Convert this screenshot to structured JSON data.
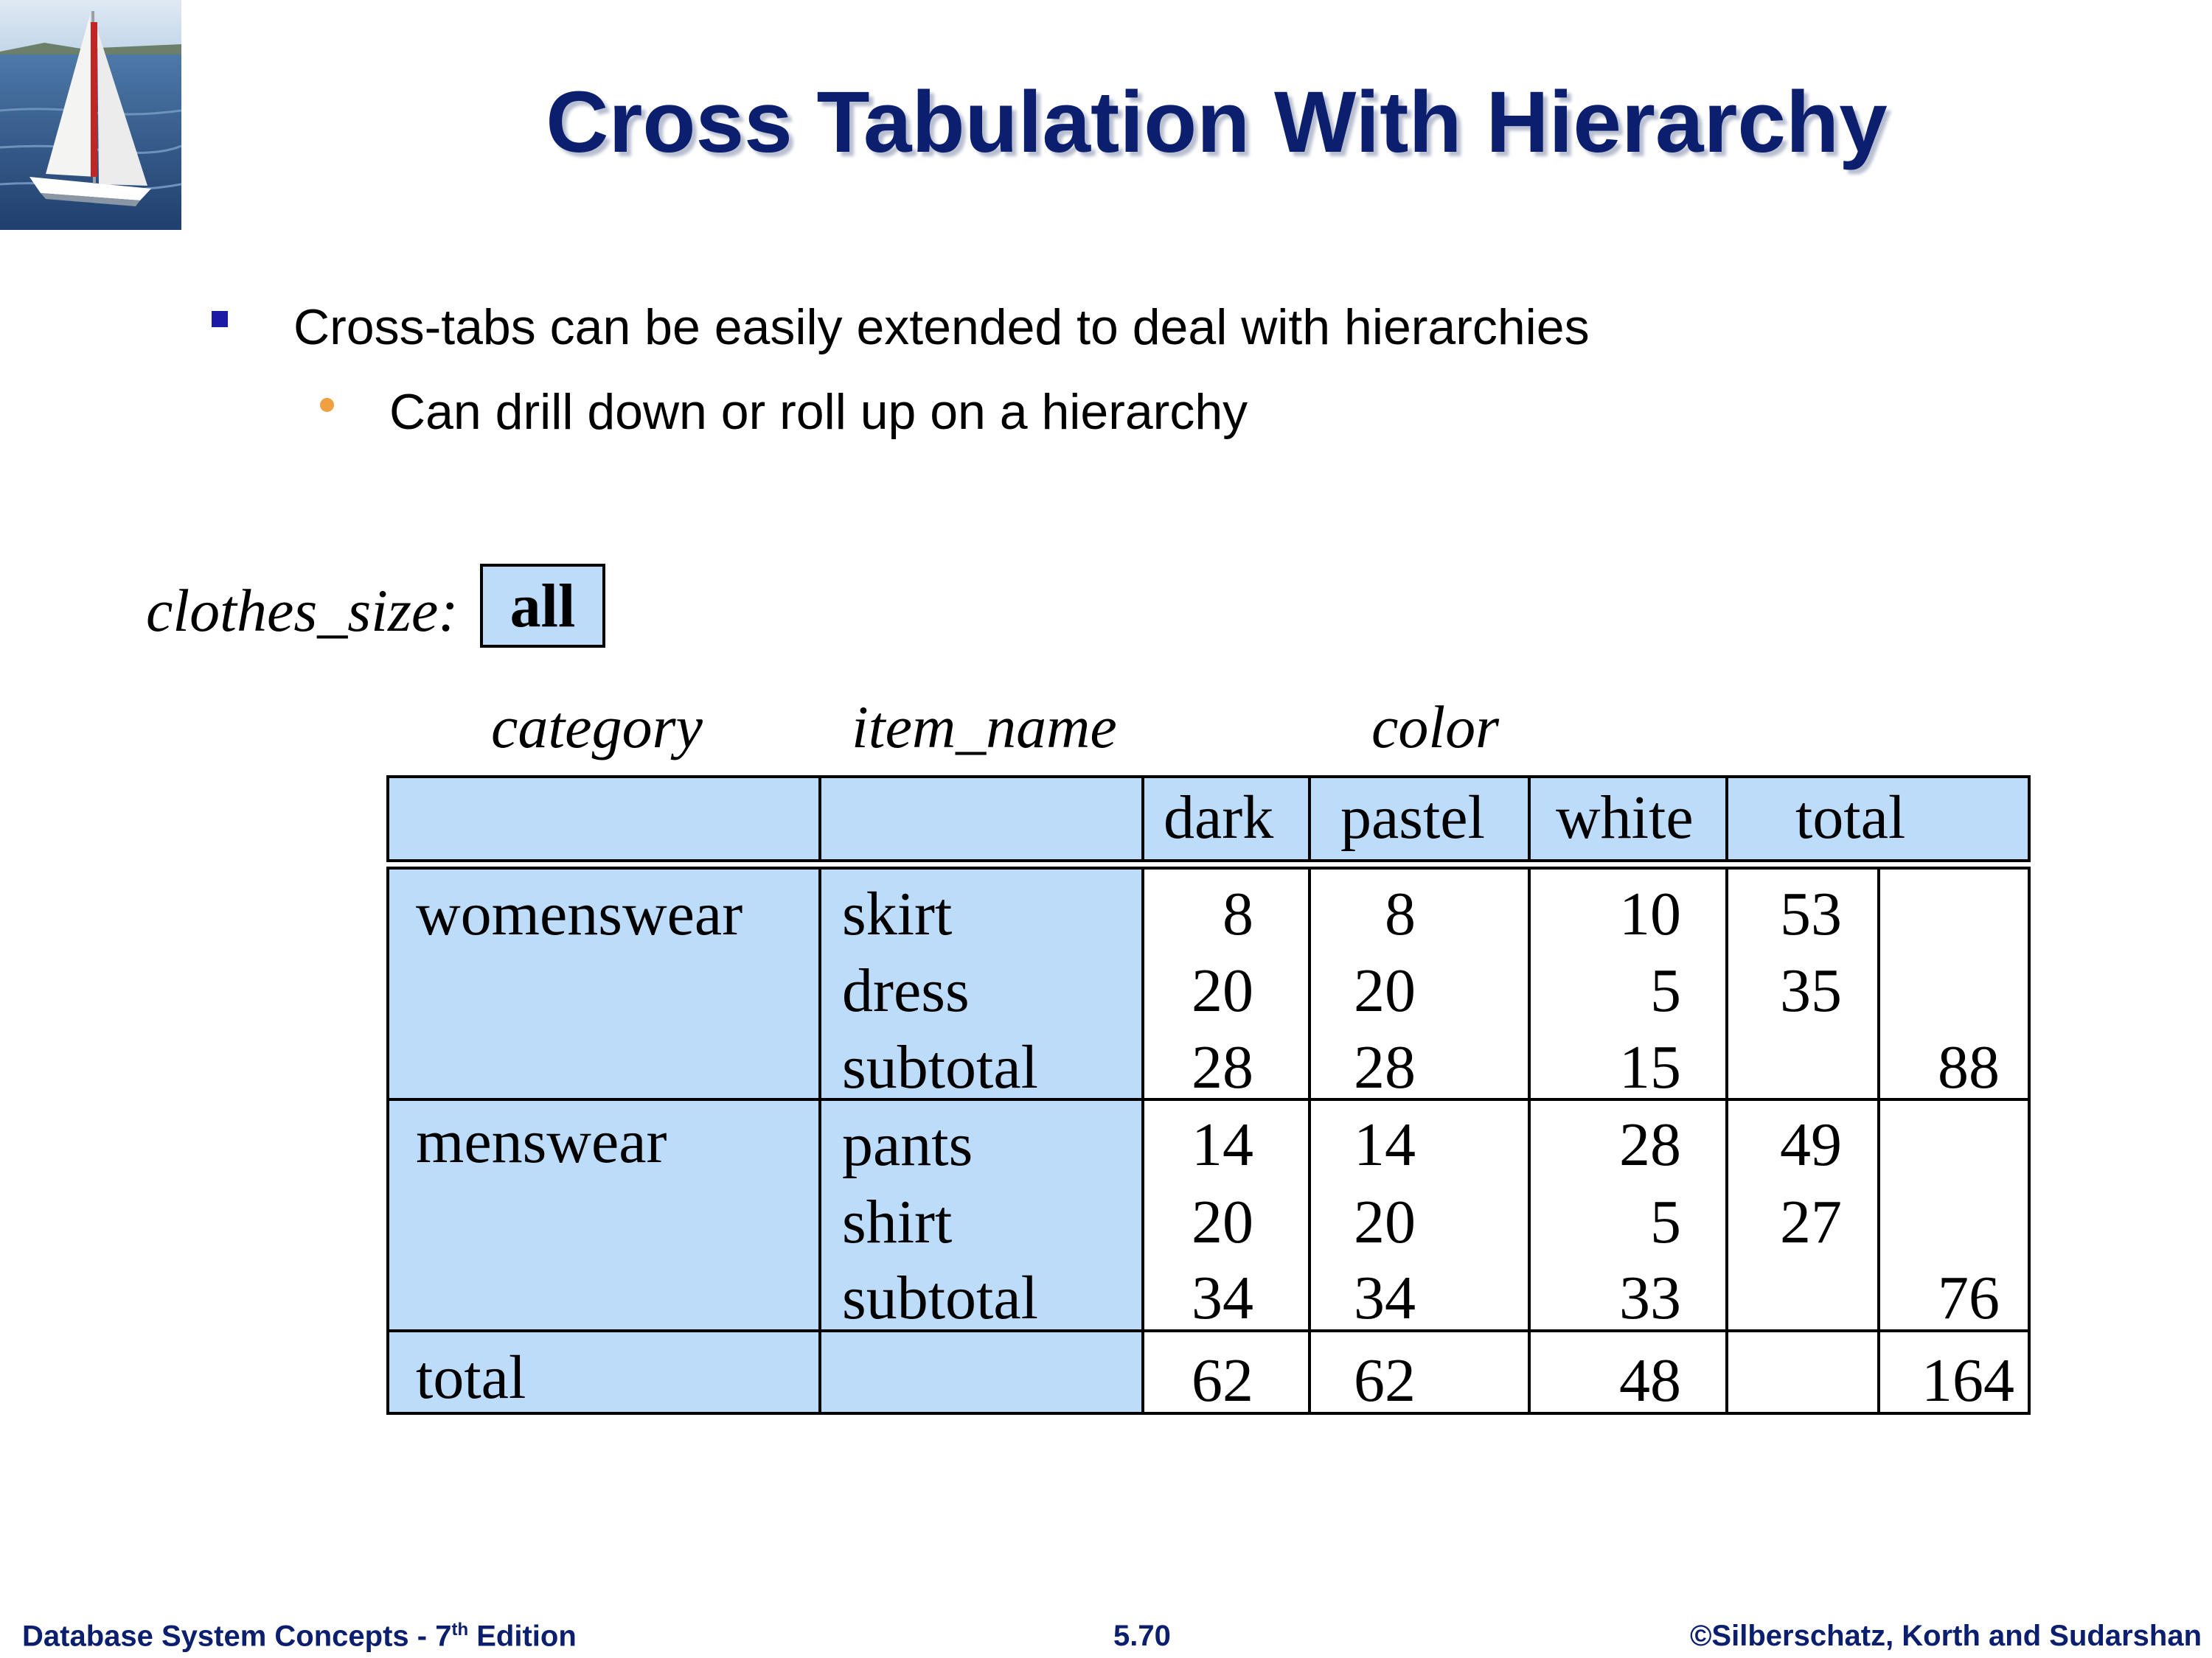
{
  "slide": {
    "title": "Cross Tabulation With Hierarchy",
    "bullets": [
      {
        "text": "Cross-tabs can be easily extended to deal with hierarchies"
      },
      {
        "text": "Can drill down or roll up on a hierarchy"
      }
    ]
  },
  "crosstab": {
    "size_label": "clothes_size:",
    "size_value": "all",
    "dim_labels": {
      "category": "category",
      "item_name": "item_name",
      "color": "color"
    },
    "col_headers": [
      "dark",
      "pastel",
      "white",
      "total"
    ],
    "groups": [
      {
        "category": "womenswear",
        "rows": [
          {
            "item": "skirt",
            "dark": "8",
            "pastel": "8",
            "white": "10",
            "total": "53",
            "subtotal": ""
          },
          {
            "item": "dress",
            "dark": "20",
            "pastel": "20",
            "white": "5",
            "total": "35",
            "subtotal": ""
          },
          {
            "item": "subtotal",
            "dark": "28",
            "pastel": "28",
            "white": "15",
            "total": "",
            "subtotal": "88"
          }
        ]
      },
      {
        "category": "menswear",
        "rows": [
          {
            "item": "pants",
            "dark": "14",
            "pastel": "14",
            "white": "28",
            "total": "49",
            "subtotal": ""
          },
          {
            "item": "shirt",
            "dark": "20",
            "pastel": "20",
            "white": "5",
            "total": "27",
            "subtotal": ""
          },
          {
            "item": "subtotal",
            "dark": "34",
            "pastel": "34",
            "white": "33",
            "total": "",
            "subtotal": "76"
          }
        ]
      }
    ],
    "total_row": {
      "label": "total",
      "dark": "62",
      "pastel": "62",
      "white": "48",
      "total": "",
      "subtotal": "164"
    }
  },
  "footer": {
    "left_text": "Database System Concepts - 7",
    "left_sup": "th",
    "left_suffix": " Edition",
    "center": "5.70",
    "right": "©Silberschatz, Korth and Sudarshan"
  },
  "colors": {
    "title": "#0b1f6e",
    "cell_fill": "#bcdcfa",
    "bullet_square": "#1a1aa6",
    "bullet_dot": "#f0a040"
  }
}
